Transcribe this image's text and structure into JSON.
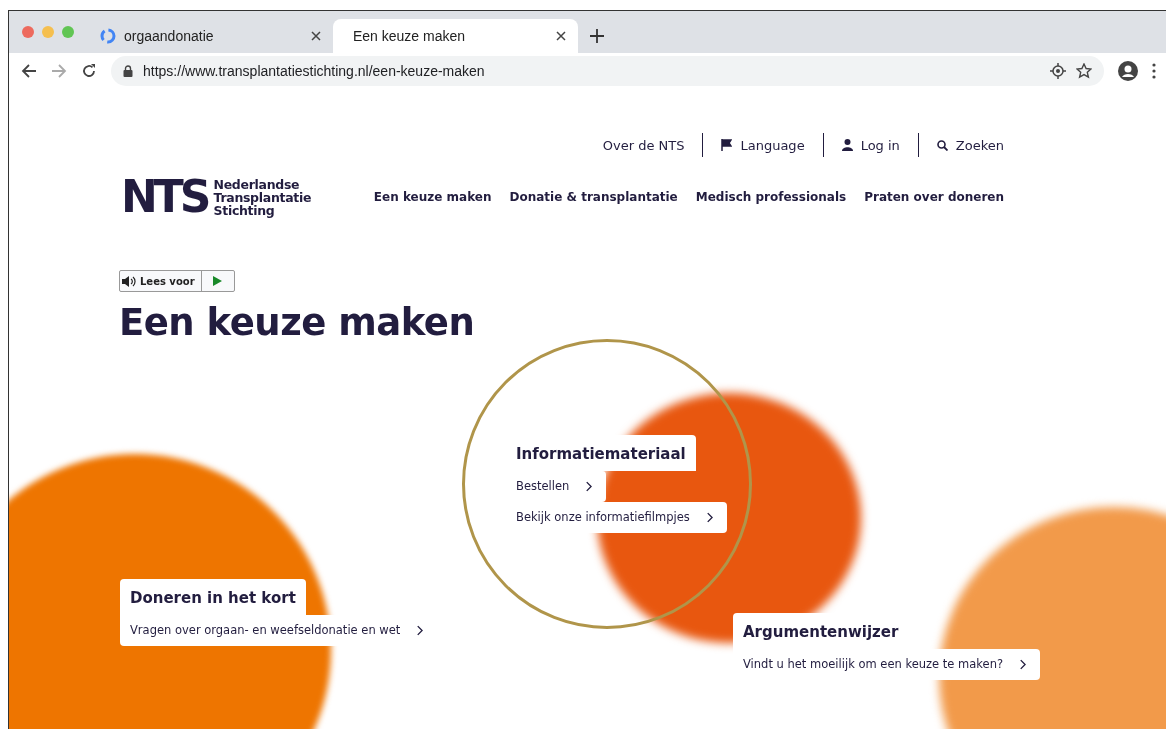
{
  "browser": {
    "tabs": [
      {
        "title": "orgaandonatie",
        "selected": false
      },
      {
        "title": "Een keuze maken",
        "selected": true
      }
    ],
    "url": "https://www.transplantatiestichting.nl/een-keuze-maken"
  },
  "logo": {
    "mark": "NTS",
    "lines": [
      "Nederlandse",
      "Transplantatie",
      "Stichting"
    ]
  },
  "utility_nav": [
    {
      "kind": "plain",
      "label": "Over de NTS"
    },
    {
      "kind": "flag",
      "label": "Language"
    },
    {
      "kind": "user",
      "label": "Log in"
    },
    {
      "kind": "search",
      "label": "Zoeken"
    }
  ],
  "main_nav": [
    "Een keuze maken",
    "Donatie & transplantatie",
    "Medisch professionals",
    "Praten over doneren"
  ],
  "read_aloud": {
    "label": "Lees voor"
  },
  "heading": "Een keuze maken",
  "cards": [
    {
      "title": "Informatiemateriaal",
      "links": [
        "Bestellen",
        "Bekijk onze informatiefilmpjes"
      ]
    },
    {
      "title": "Doneren in het kort",
      "links": [
        "Vragen over orgaan- en weefseldonatie en wet"
      ]
    },
    {
      "title": "Argumentenwijzer",
      "links": [
        "Vindt u het moeilijk om een keuze te maken?"
      ]
    }
  ]
}
